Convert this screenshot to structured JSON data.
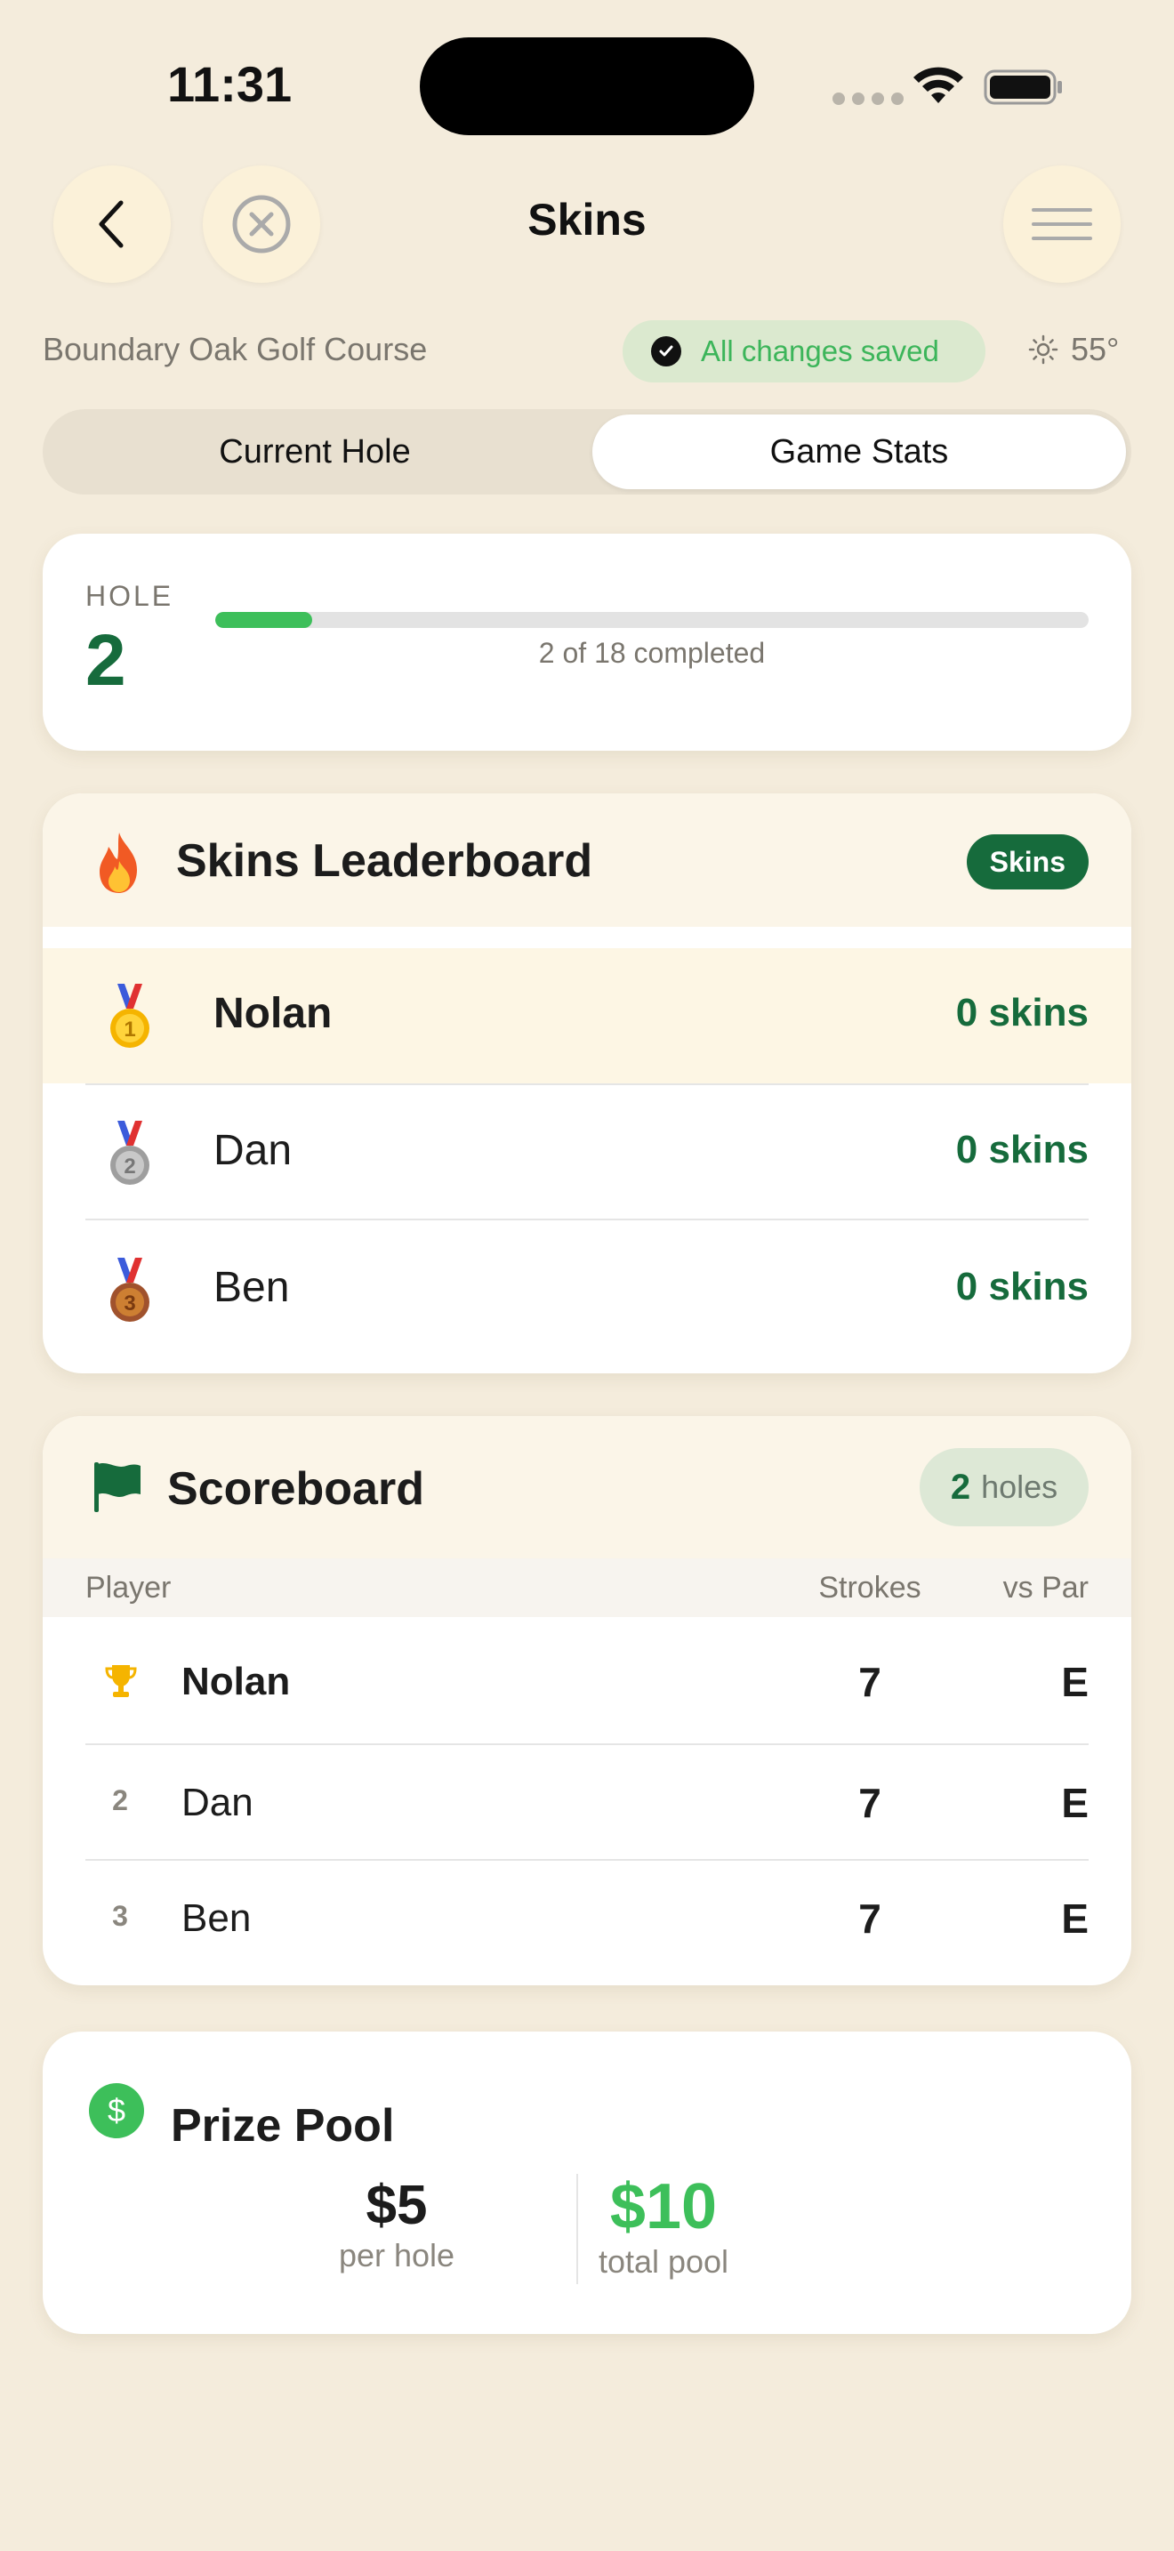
{
  "status_bar": {
    "time": "11:31"
  },
  "nav": {
    "title": "Skins"
  },
  "course": {
    "name": "Boundary Oak Golf Course",
    "save_status": "All changes saved",
    "temperature": "55°"
  },
  "tabs": [
    {
      "label": "Current Hole",
      "active": false
    },
    {
      "label": "Game Stats",
      "active": true
    }
  ],
  "hole": {
    "label": "HOLE",
    "number": "2",
    "progress_text": "2 of 18 completed",
    "completed": 2,
    "total": 18
  },
  "leaderboard": {
    "icon": "fire-icon",
    "title": "Skins Leaderboard",
    "badge": "Skins",
    "rows": [
      {
        "medal": "gold-medal-icon",
        "name": "Nolan",
        "value": "0 skins"
      },
      {
        "medal": "silver-medal-icon",
        "name": "Dan",
        "value": "0 skins"
      },
      {
        "medal": "bronze-medal-icon",
        "name": "Ben",
        "value": "0 skins"
      }
    ]
  },
  "scoreboard": {
    "icon": "flag-icon",
    "title": "Scoreboard",
    "holes_count": "2",
    "holes_label": "holes",
    "columns": {
      "player": "Player",
      "strokes": "Strokes",
      "vs_par": "vs Par"
    },
    "rows": [
      {
        "rank": "",
        "rank_icon": "trophy-icon",
        "name": "Nolan",
        "strokes": "7",
        "vs_par": "E"
      },
      {
        "rank": "2",
        "name": "Dan",
        "strokes": "7",
        "vs_par": "E"
      },
      {
        "rank": "3",
        "name": "Ben",
        "strokes": "7",
        "vs_par": "E"
      }
    ]
  },
  "prize_pool": {
    "icon": "dollar-icon",
    "icon_glyph": "$",
    "title": "Prize Pool",
    "per_hole_value": "$5",
    "per_hole_label": "per hole",
    "total_value": "$10",
    "total_label": "total pool"
  },
  "colors": {
    "accent_green": "#166b3c",
    "bright_green": "#3dbf5a",
    "background": "#f4ecdc"
  }
}
